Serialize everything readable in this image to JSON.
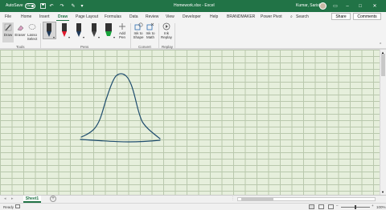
{
  "titlebar": {
    "autosave_label": "AutoSave",
    "autosave_state": "On",
    "filename": "Homework.xlsx",
    "app": "Excel",
    "user": "Kumar, Sarisha"
  },
  "menu": {
    "tabs": [
      "File",
      "Home",
      "Insert",
      "Draw",
      "Page Layout",
      "Formulas",
      "Data",
      "Review",
      "View",
      "Developer",
      "Help",
      "BRANDMAKER",
      "Power Pivot"
    ],
    "active": "Draw",
    "search": "Search",
    "share": "Share",
    "comments": "Comments"
  },
  "ribbon": {
    "draw": "Draw",
    "eraser": "Eraser",
    "lasso": "Lasso",
    "lasso2": "Select",
    "tools_group": "Tools",
    "pens_group": "Pens",
    "add_pen": "Add",
    "add_pen2": "Pen",
    "ink_to_shape": "Ink to",
    "ink_to_shape2": "Shape",
    "ink_to_math": "Ink to",
    "ink_to_math2": "Math",
    "convert_group": "Convert",
    "ink_replay": "Ink",
    "ink_replay2": "Replay",
    "replay_group": "Replay",
    "pen_colors": [
      "#1f3a5a",
      "#e0182b",
      "#1f3a5a",
      "#444444",
      "#17a33a"
    ]
  },
  "sheets": {
    "tabs": [
      "Sheet1"
    ]
  },
  "status": {
    "ready": "Ready",
    "zoom": "100%"
  },
  "colors": {
    "accent": "#217346",
    "ink": "#1f4d6e",
    "gridfill": "#e6efdc"
  }
}
